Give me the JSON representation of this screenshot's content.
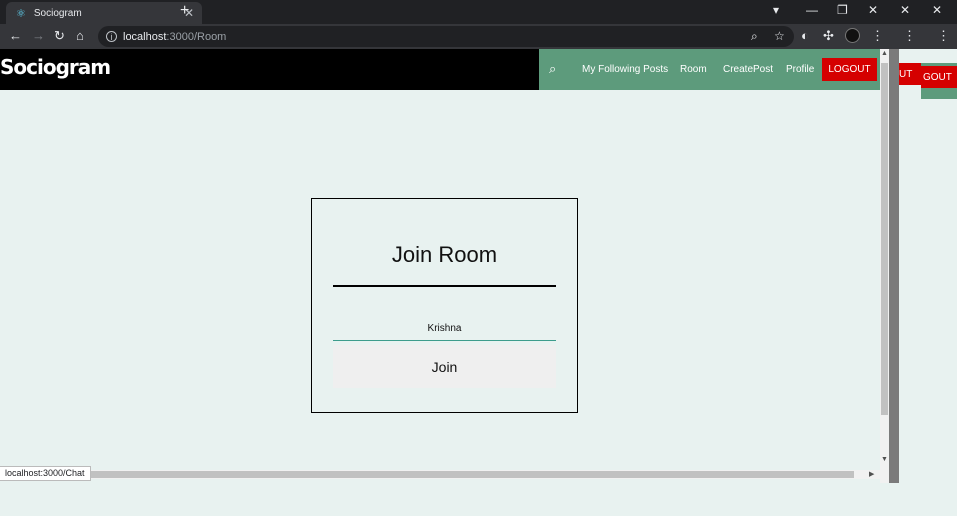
{
  "browser": {
    "tab_title": "Sociogram",
    "url_host": "localhost",
    "url_path": ":3000/Room",
    "status_link": "localhost:3000/Chat"
  },
  "app": {
    "brand": "Sociogram",
    "nav": {
      "links": [
        "My Following Posts",
        "Room",
        "CreatePost",
        "Profile"
      ],
      "logout": "LOGOUT",
      "ghost_logout_1": "UT",
      "ghost_logout_2": "GOUT"
    },
    "join_room": {
      "title": "Join Room",
      "name_value": "Krishna",
      "join_label": "Join"
    }
  },
  "colors": {
    "nav_green": "#5d9b7c",
    "logout_red": "#d50000",
    "page_bg": "#e8f2f0"
  }
}
